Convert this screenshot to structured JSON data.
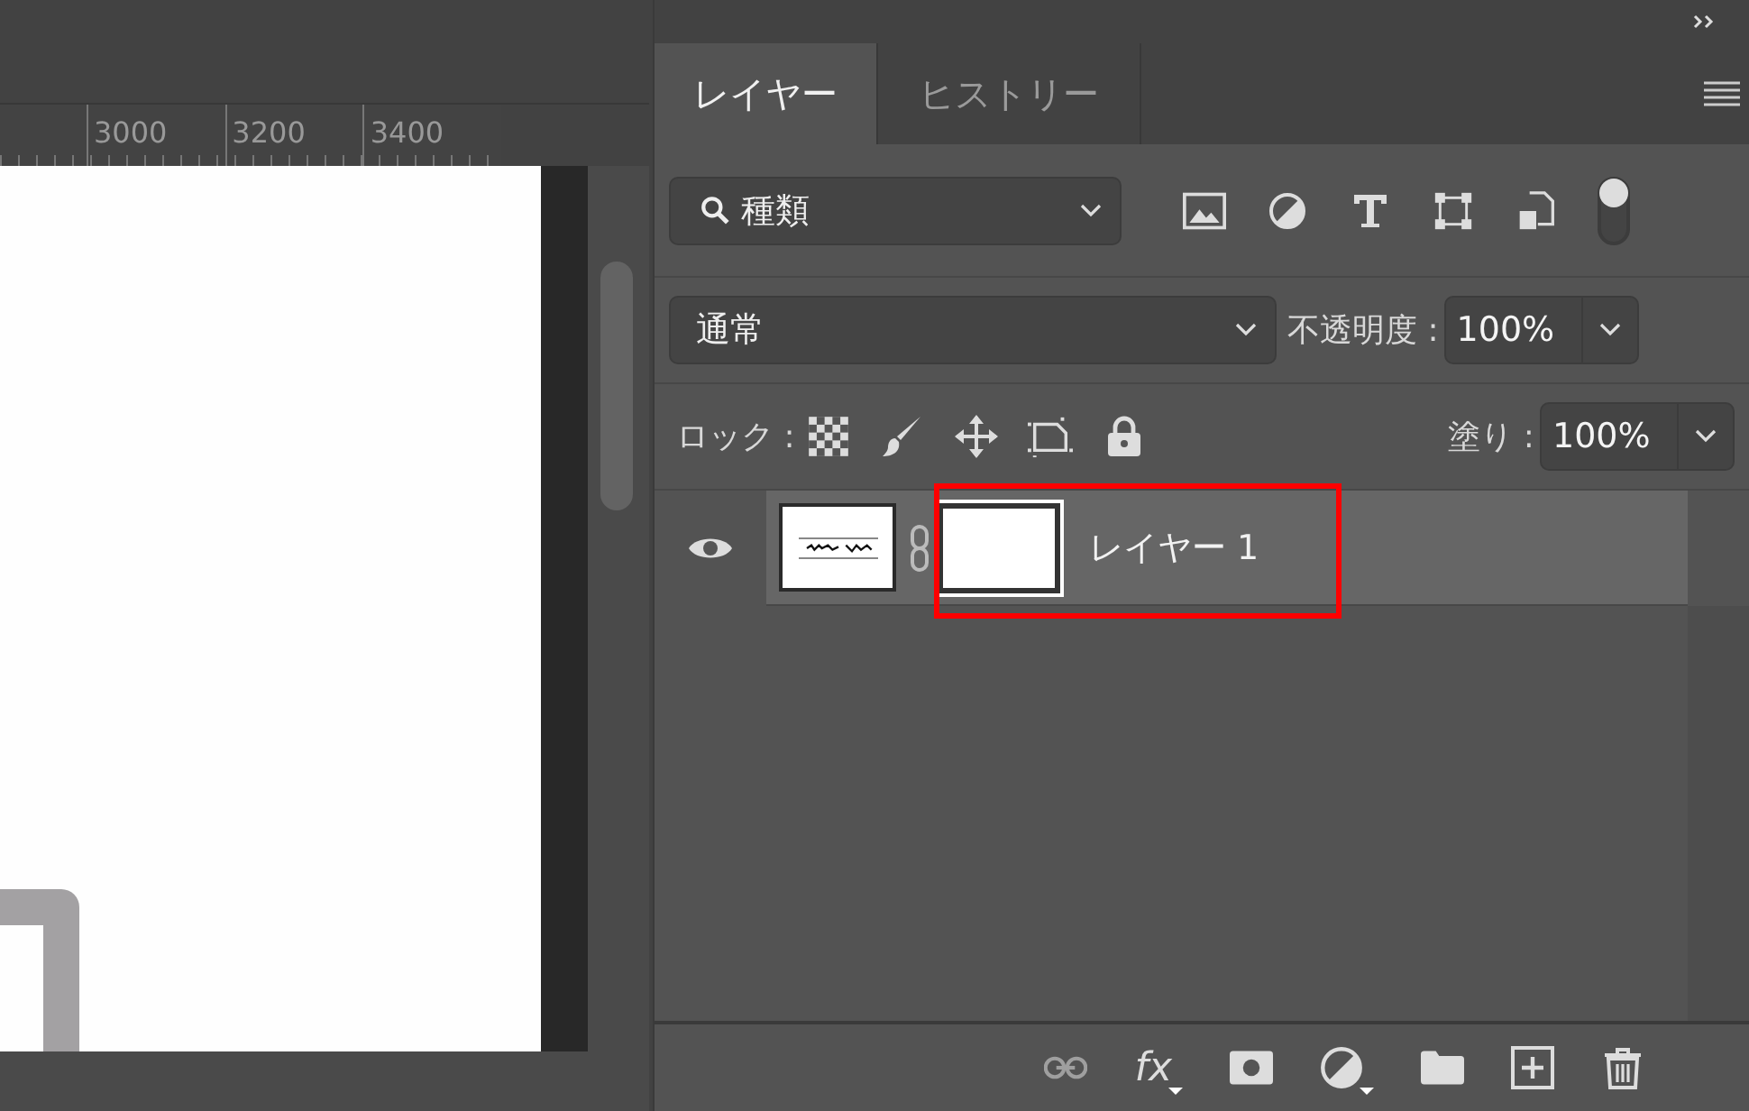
{
  "ruler": {
    "labels": [
      "3000",
      "3200",
      "3400"
    ]
  },
  "panel": {
    "tabs": [
      {
        "label": "レイヤー",
        "selected": true
      },
      {
        "label": "ヒストリー",
        "selected": false
      }
    ],
    "filter": {
      "value": "種類",
      "on": true
    },
    "blend_mode": {
      "value": "通常"
    },
    "opacity": {
      "label": "不透明度 :",
      "value": "100%"
    },
    "lock": {
      "label": "ロック :"
    },
    "fill": {
      "label": "塗り :",
      "value": "100%"
    },
    "layers": [
      {
        "name": "レイヤー 1",
        "visible": true,
        "selected": true,
        "mask_selected": true,
        "highlighted": true
      }
    ],
    "bottom_tools": [
      {
        "kind": "link",
        "disabled": true
      },
      {
        "kind": "fx",
        "label": "fx",
        "disabled": false
      },
      {
        "kind": "mask",
        "disabled": false
      },
      {
        "kind": "adjustment",
        "disabled": false
      },
      {
        "kind": "folder",
        "disabled": false
      },
      {
        "kind": "new",
        "disabled": false
      },
      {
        "kind": "trash",
        "disabled": false
      }
    ]
  }
}
